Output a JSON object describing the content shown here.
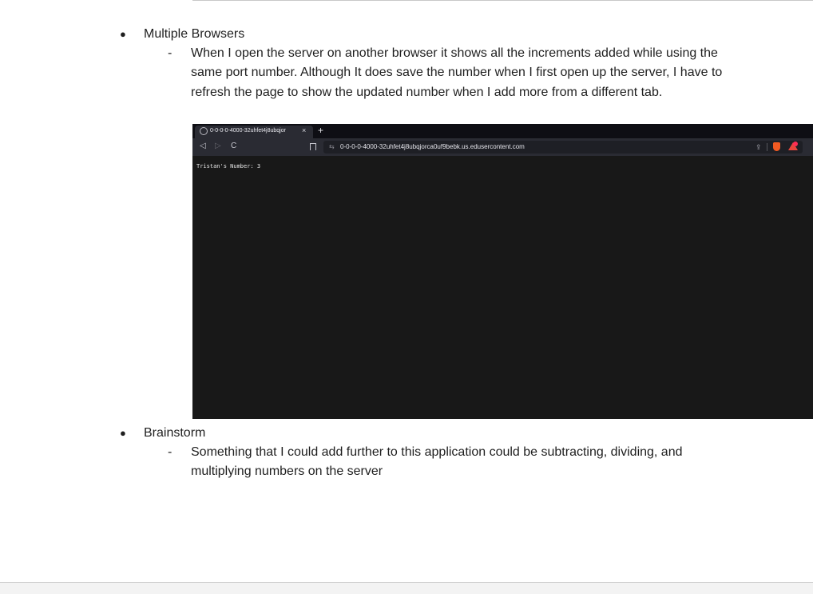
{
  "sections": [
    {
      "bullet": "●",
      "title": "Multiple Browsers",
      "sub": [
        {
          "dash": "-",
          "text": "When I open the server on another browser it shows all the increments added while using the same port number. Although It does save the number when I first open up the server, I have to refresh the page to show the updated number when I add more from a different tab."
        }
      ]
    },
    {
      "bullet": "●",
      "title": "Brainstorm",
      "sub": [
        {
          "dash": "-",
          "text": "Something that I could add further to this application could be subtracting, dividing, and multiplying numbers on the server"
        }
      ]
    }
  ],
  "screenshot": {
    "tab_title": "0-0-0-0-4000-32uhfet4j8ubqjor",
    "tab_close": "×",
    "new_tab": "+",
    "back": "◁",
    "forward": "▷",
    "reload": "C",
    "url": "0-0-0-0-4000-32uhfet4j8ubqjorca0uf9bebk.us.edusercontent.com",
    "url_icon": "⇆",
    "share": "⇪",
    "page_text": "Tristan's Number: 3",
    "icons": [
      "globe-icon",
      "close-icon",
      "plus-icon",
      "back-icon",
      "forward-icon",
      "reload-icon",
      "bookmark-icon",
      "site-info-icon",
      "share-icon",
      "brave-shield-icon",
      "brave-rewards-icon"
    ],
    "colors": {
      "content_bg": "#181818",
      "toolbar_bg": "#2a2b33",
      "tabbar_bg": "#0e0e14",
      "brave_orange": "#f25a22"
    }
  }
}
